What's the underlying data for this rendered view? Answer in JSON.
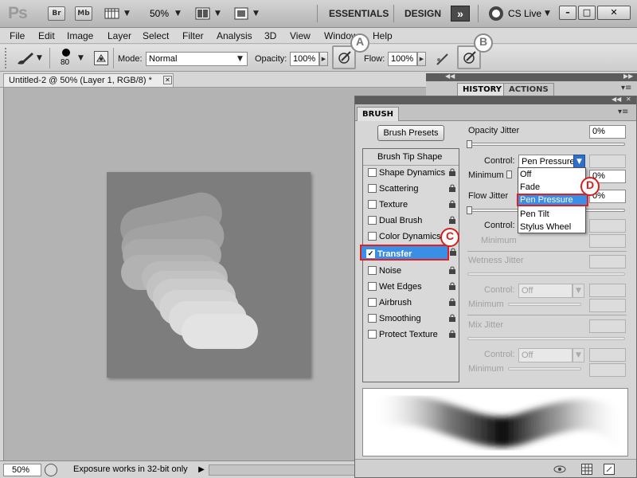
{
  "appbar": {
    "logo": "Ps",
    "bridge": "Br",
    "minibridge": "Mb",
    "zoom": "50%",
    "workspace_essentials": "ESSENTIALS",
    "workspace_design": "DESIGN",
    "more": "»",
    "cs_live": "CS Live",
    "minimize": "–",
    "maximize": "□",
    "close": "✕"
  },
  "menu": [
    "File",
    "Edit",
    "Image",
    "Layer",
    "Select",
    "Filter",
    "Analysis",
    "3D",
    "View",
    "Window",
    "Help"
  ],
  "options": {
    "brush_size": "80",
    "mode_label": "Mode:",
    "mode_value": "Normal",
    "opacity_label": "Opacity:",
    "opacity_value": "100%",
    "flow_label": "Flow:",
    "flow_value": "100%",
    "callout_a": "A",
    "callout_b": "B"
  },
  "document": {
    "tab_title": "Untitled-2 @ 50% (Layer 1, RGB/8) *",
    "tab_close": "✕"
  },
  "status": {
    "zoom": "50%",
    "message": "Exposure works in 32-bit only"
  },
  "history_panel": {
    "tab_history": "HISTORY",
    "tab_actions": "ACTIONS"
  },
  "brush_panel": {
    "tab": "BRUSH",
    "presets_button": "Brush Presets",
    "tip_shape": "Brush Tip Shape",
    "items": [
      {
        "label": "Shape Dynamics",
        "checked": ""
      },
      {
        "label": "Scattering",
        "checked": ""
      },
      {
        "label": "Texture",
        "checked": ""
      },
      {
        "label": "Dual Brush",
        "checked": ""
      },
      {
        "label": "Color Dynamics",
        "checked": ""
      },
      {
        "label": "Transfer",
        "checked": "✓"
      },
      {
        "label": "Noise",
        "checked": ""
      },
      {
        "label": "Wet Edges",
        "checked": ""
      },
      {
        "label": "Airbrush",
        "checked": ""
      },
      {
        "label": "Smoothing",
        "checked": ""
      },
      {
        "label": "Protect Texture",
        "checked": ""
      }
    ],
    "callout_c": "C",
    "callout_d": "D",
    "opacity_jitter": "Opacity Jitter",
    "opacity_jitter_value": "0%",
    "control_label": "Control:",
    "control_value": "Pen Pressure",
    "minimum_label": "Minimum",
    "minimum_value": "0%",
    "flow_jitter": "Flow Jitter",
    "flow_jitter_value": "0%",
    "control2_label": "Control:",
    "minimum2_label": "Minimum",
    "wetness_jitter": "Wetness Jitter",
    "control3_label": "Control:",
    "control3_value": "Off",
    "minimum3_label": "Minimum",
    "mix_jitter": "Mix Jitter",
    "control4_label": "Control:",
    "control4_value": "Off",
    "minimum4_label": "Minimum",
    "dropdown_options": [
      "Off",
      "Fade",
      "Pen Pressure",
      "Pen Tilt",
      "Stylus Wheel"
    ]
  }
}
